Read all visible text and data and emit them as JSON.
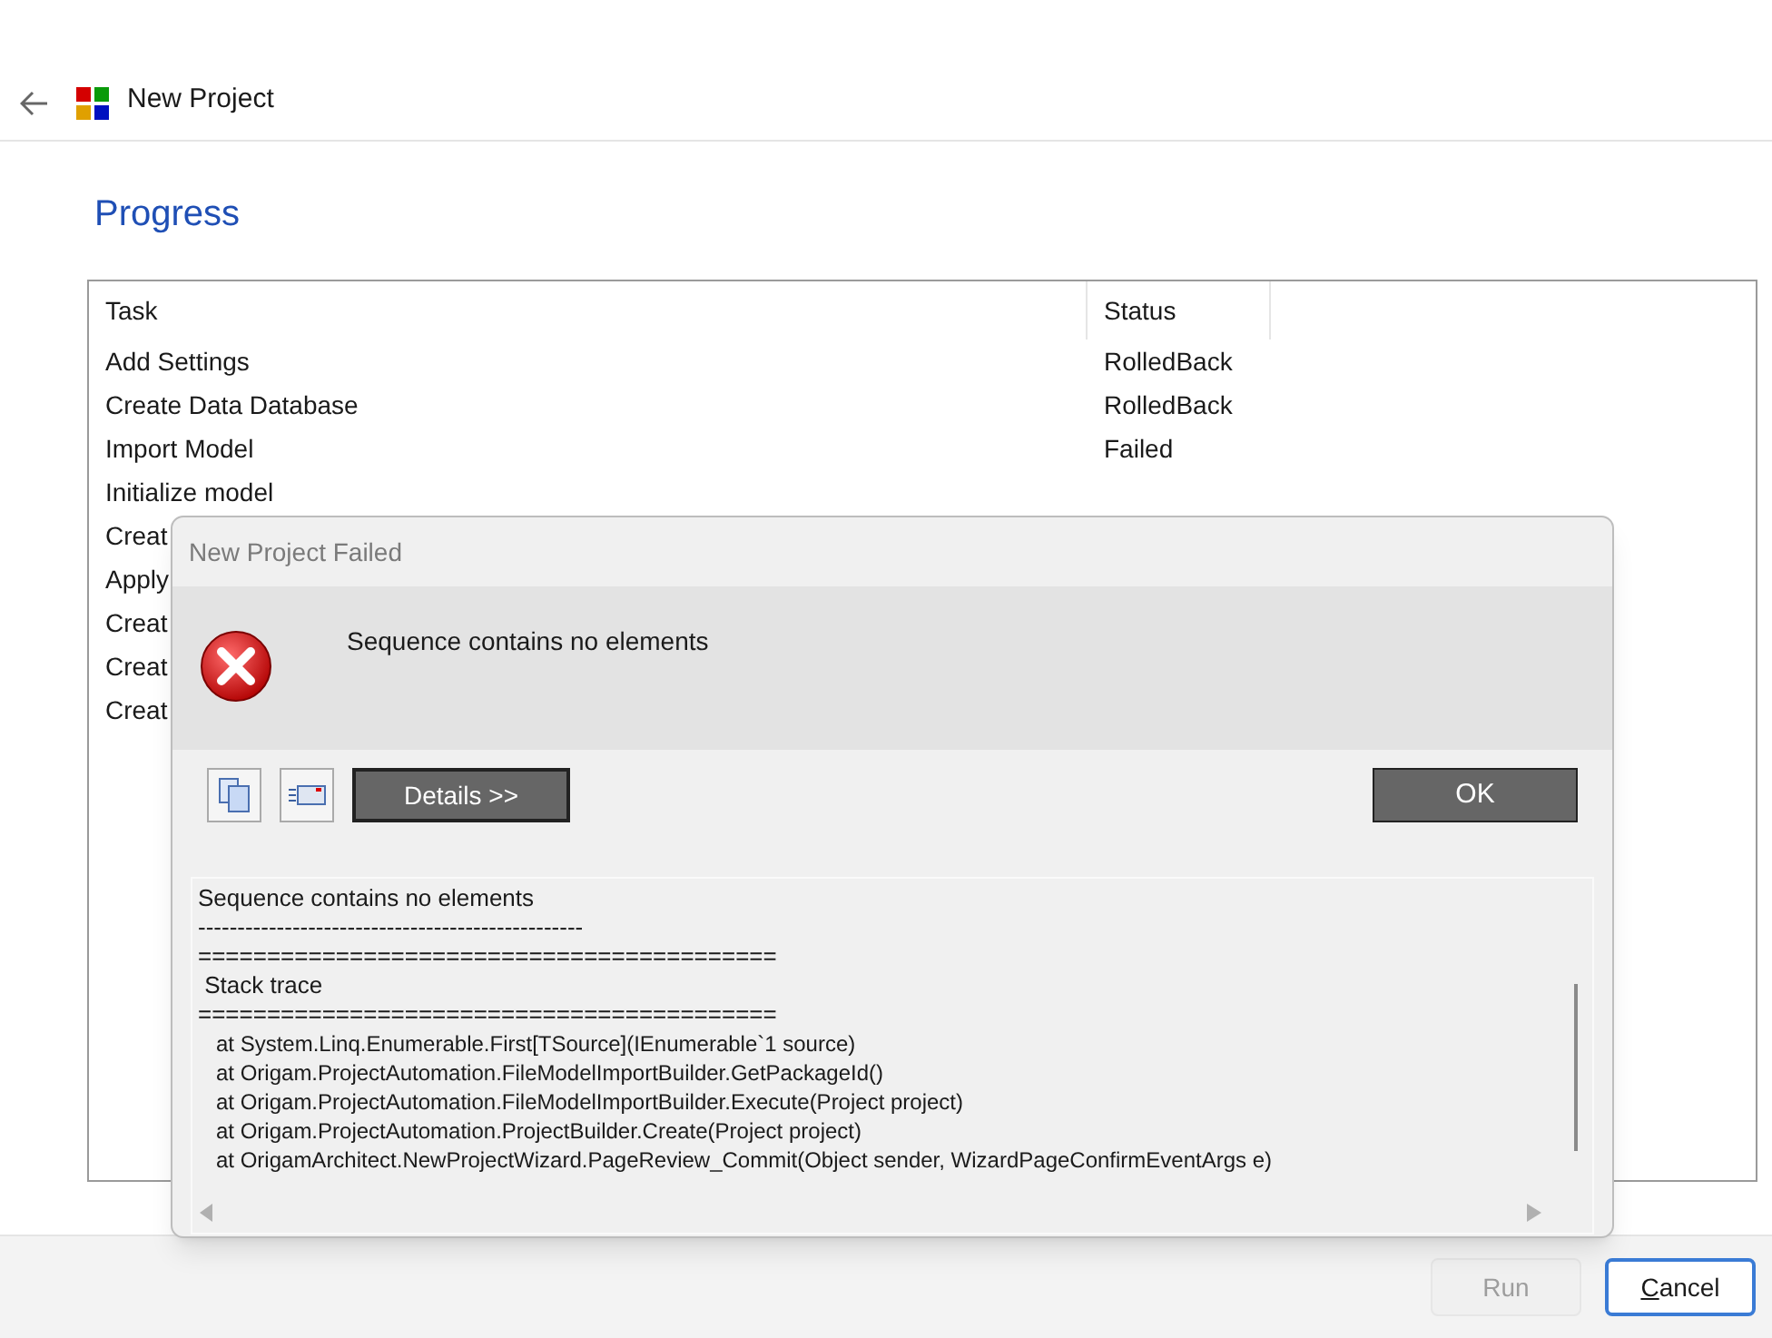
{
  "window": {
    "title": "New Project"
  },
  "heading": "Progress",
  "table": {
    "columns": [
      "Task",
      "Status"
    ],
    "rows": [
      {
        "task": "Add Settings",
        "status": "RolledBack"
      },
      {
        "task": "Create Data Database",
        "status": "RolledBack"
      },
      {
        "task": "Import Model",
        "status": "Failed"
      },
      {
        "task": "Initialize model"
      },
      {
        "task": "Creat"
      },
      {
        "task": "Apply"
      },
      {
        "task": "Creat"
      },
      {
        "task": "Creat"
      },
      {
        "task": "Creat"
      }
    ]
  },
  "buttons": [
    {
      "label": "Run",
      "disabled": true,
      "mnemonic": false
    },
    {
      "label": "Cancel",
      "disabled": false,
      "mnemonic": true
    }
  ],
  "dialog": {
    "title": "New Project Failed",
    "message": "Sequence contains no elements",
    "details_button": "Details >>",
    "ok_button": "OK",
    "details": [
      "Sequence contains no elements",
      "-------------------------------------------------",
      "==========================================",
      " Stack trace",
      "==========================================",
      "   at System.Linq.Enumerable.First[TSource](IEnumerable`1 source)",
      "   at Origam.ProjectAutomation.FileModelImportBuilder.GetPackageId()",
      "   at Origam.ProjectAutomation.FileModelImportBuilder.Execute(Project project)",
      "   at Origam.ProjectAutomation.ProjectBuilder.Create(Project project)",
      "   at OrigamArchitect.NewProjectWizard.PageReview_Commit(Object sender, WizardPageConfirmEventArgs e)"
    ]
  }
}
